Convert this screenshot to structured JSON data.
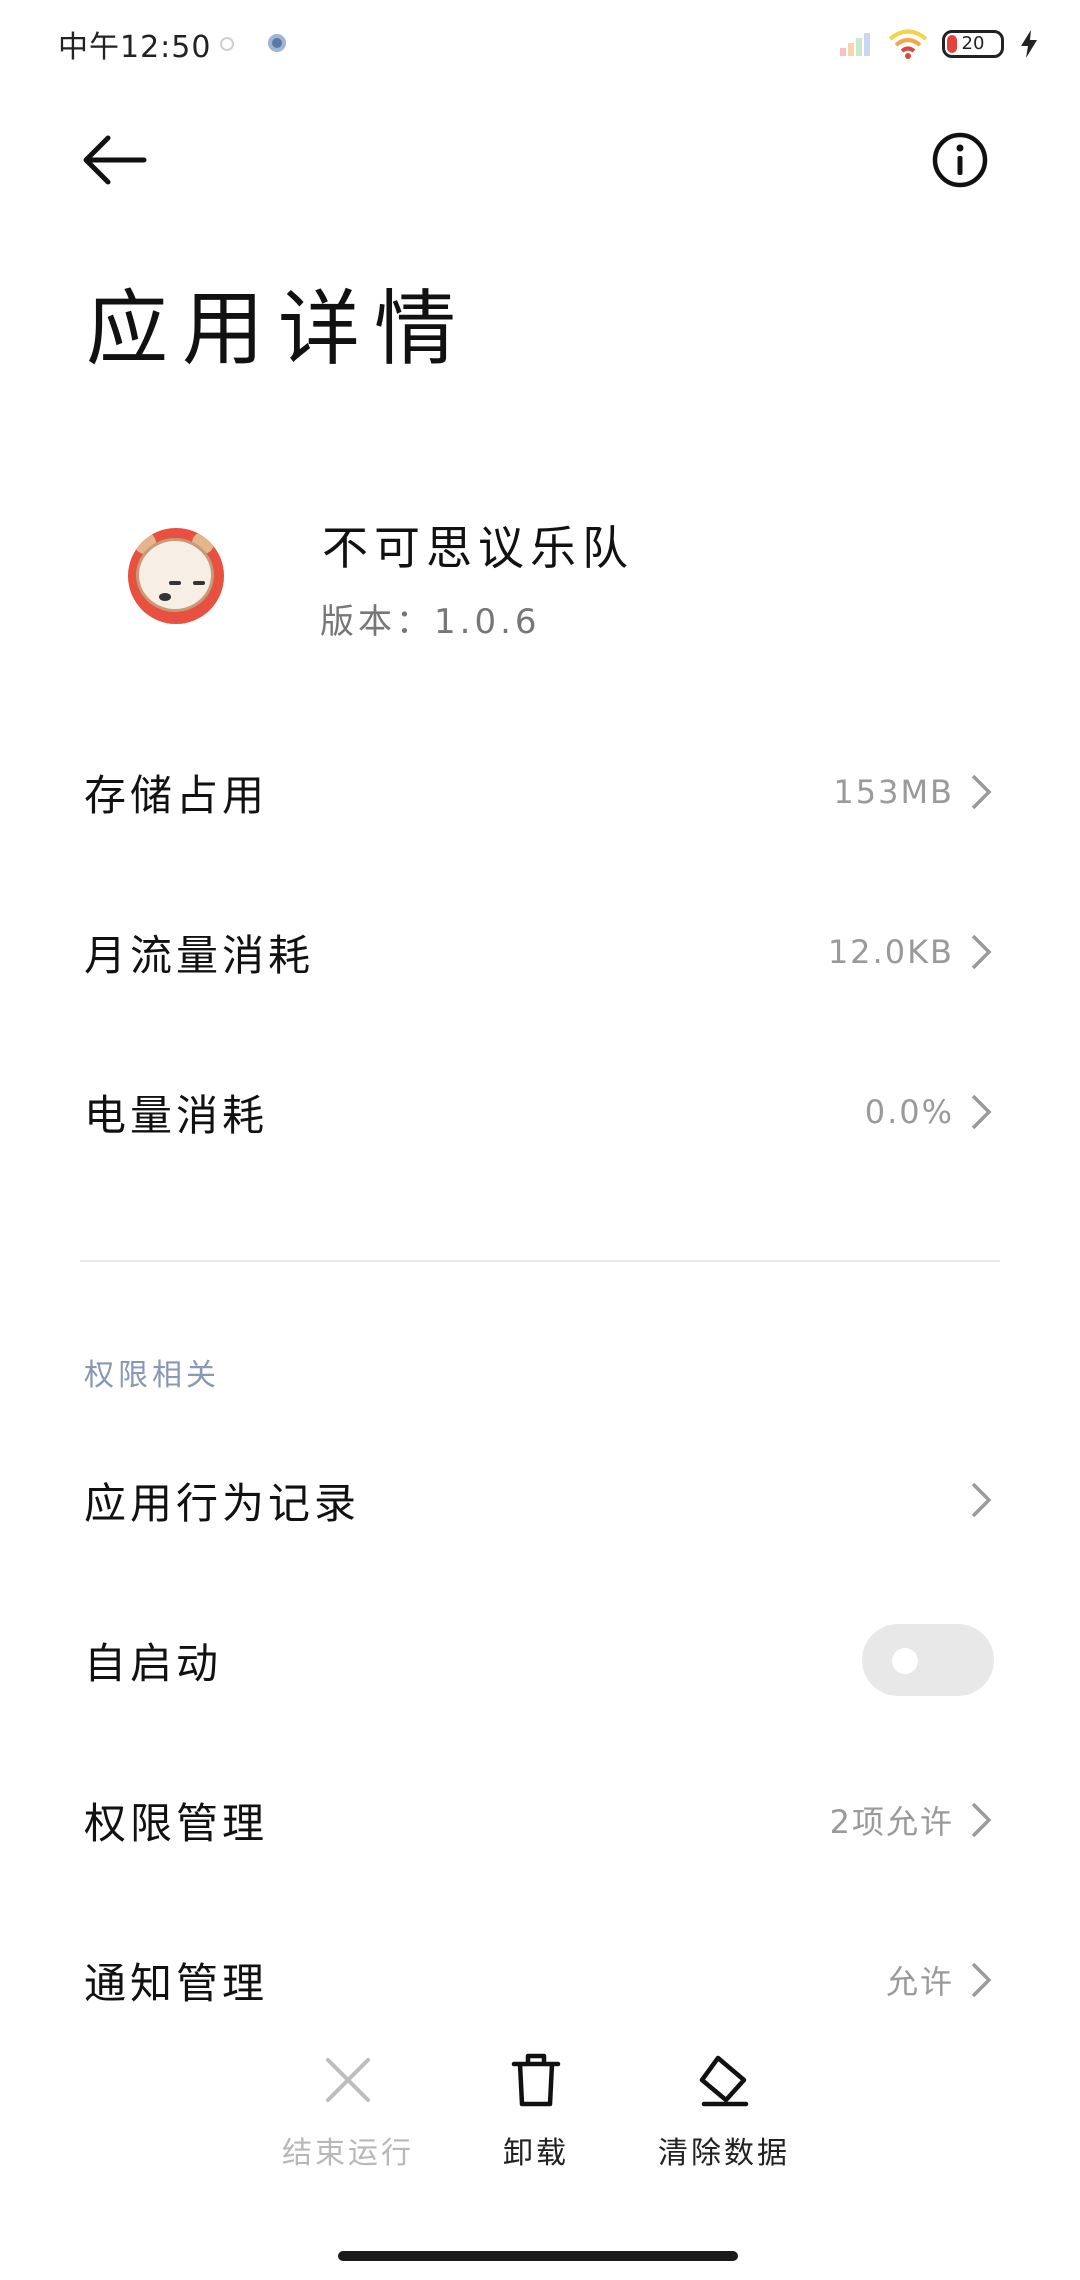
{
  "status_bar": {
    "time": "中午12:50",
    "battery_level": "20"
  },
  "header": {
    "title": "应用详情"
  },
  "app": {
    "name": "不可思议乐队",
    "version": "版本：1.0.6"
  },
  "usage_rows": [
    {
      "label": "存储占用",
      "value": "153MB"
    },
    {
      "label": "月流量消耗",
      "value": "12.0KB"
    },
    {
      "label": "电量消耗",
      "value": "0.0%"
    }
  ],
  "permissions_section": {
    "header": "权限相关",
    "rows": [
      {
        "label": "应用行为记录",
        "value": ""
      },
      {
        "label": "自启动",
        "toggle_on": false
      },
      {
        "label": "权限管理",
        "value": "2项允许"
      },
      {
        "label": "通知管理",
        "value": "允许"
      }
    ]
  },
  "bottom_actions": [
    {
      "label": "结束运行",
      "icon": "close-icon",
      "enabled": false
    },
    {
      "label": "卸载",
      "icon": "trash-icon",
      "enabled": true
    },
    {
      "label": "清除数据",
      "icon": "eraser-icon",
      "enabled": true
    }
  ],
  "colors": {
    "section_header": "#8a97b5",
    "battery_low": "#e0443c",
    "toggle_off": "#e8e8e8"
  }
}
